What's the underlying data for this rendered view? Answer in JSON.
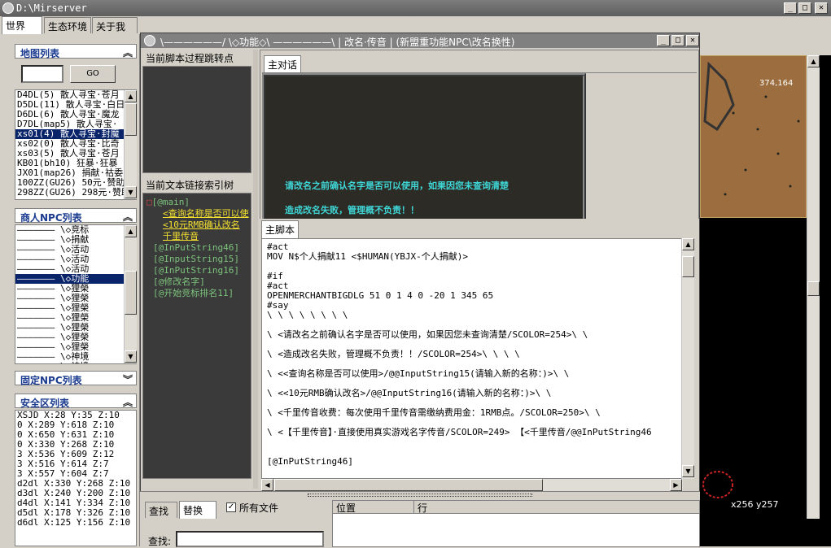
{
  "window": {
    "title": "D:\\Mirserver"
  },
  "main_tabs": [
    "世界",
    "生态环境",
    "关于我们"
  ],
  "map_list": {
    "title": "地图列表",
    "go_label": "GO",
    "search_value": "",
    "items": [
      "D4DL(5) 散人寻宝·苍月",
      "D5DL(11) 散人寻宝·白日",
      "D6DL(6) 散人寻宝·魔龙",
      "D7DL(map5) 散人寻宝·",
      "xs01(4) 散人寻宝·封魔",
      "xs02(0) 散人寻宝·比奇",
      "xs03(5) 散人寻宝·苍月",
      "KB01(bh10) 狂暴·狂暴",
      "JX01(map26) 捐献·祜委",
      "100ZZ(GU26) 50元·赞助",
      "298ZZ(GU26) 298元·赞助"
    ],
    "selected_index": 4
  },
  "npc_list": {
    "title": "商人NPC列表",
    "items": [
      "\\◇竞标",
      "\\◇捐献",
      "\\◇活动",
      "\\◇活动",
      "\\◇活动",
      "\\◇功能",
      "\\◇狸榮",
      "\\◇狸榮",
      "\\◇狸榮",
      "\\◇狸榮",
      "\\◇狸榮",
      "\\◇狸榮",
      "\\◇狸榮",
      "\\◇神境",
      "\\◇神境"
    ],
    "selected_index": 5
  },
  "fixed_npc": {
    "title": "固定NPC列表"
  },
  "safe_zone": {
    "title": "安全区列表",
    "items": [
      "XSJD X:28 Y:35 Z:10",
      "0 X:289 Y:618 Z:10",
      "0 X:650 Y:631 Z:10",
      "0 X:330 Y:268 Z:10",
      "3 X:536 Y:609 Z:12",
      "3 X:516 Y:614 Z:7",
      "3 X:557 Y:604 Z:7",
      "d2dl X:330 Y:268 Z:10",
      "d3dl X:240 Y:200 Z:10",
      "d4dl X:141 Y:334 Z:10",
      "d5dl X:178 Y:326 Z:10",
      "d6dl X:125 Y:156 Z:10"
    ]
  },
  "dialog": {
    "title": "\\——————/ \\◇功能◇\\ ——————\\ | 改名·传音 |   (新盟重功能NPC\\改名换性)",
    "jump_label": "当前脚本过程跳转点",
    "link_label": "当前文本链接索引树",
    "tab_main_dialog": "主对话",
    "tab_main_script": "主脚本",
    "preview_lines": [
      "请改名之前确认名字是否可以使用，如果因您未查询清楚",
      "造成改名失败，管理概不负责！！"
    ],
    "tree": [
      {
        "text": "[@main]",
        "level": 0
      },
      {
        "text": "<查询名称是否可以使",
        "level": 2,
        "link": true
      },
      {
        "text": "<10元RMB确认改名",
        "level": 2,
        "link": true
      },
      {
        "text": "千里传音",
        "level": 2,
        "link": true
      },
      {
        "text": "[@InPutString46]",
        "level": 1
      },
      {
        "text": "[@InputString15]",
        "level": 1
      },
      {
        "text": "[@InPutString16]",
        "level": 1
      },
      {
        "text": "[@修改名字]",
        "level": 1
      },
      {
        "text": "[@开始竞标排名11]",
        "level": 1
      }
    ],
    "code": [
      "#act",
      "MOV N$个人捐献11 <$HUMAN(YBJX-个人捐献)>",
      "",
      "#if",
      "#act",
      "OPENMERCHANTBIGDLG 51 0 1 4 0 -20 1 345 65",
      "#say",
      "\\ \\ \\ \\ \\ \\ \\ \\",
      "",
      "\\    <请改名之前确认名字是否可以使用，如果因您未查询清楚/SCOLOR=254>\\ \\",
      "",
      "\\    <造成改名失败，管理概不负责！！/SCOLOR=254>\\ \\ \\ \\",
      "",
      "\\      <<查询名称是否可以使用>/@@InputString15(请输入新的名称：)>\\ \\",
      "",
      "\\      <<10元RMB确认改名>/@@InputString16(请输入新的名称：)>\\ \\",
      "",
      "\\    <千里传音收费：每次使用千里传音需缴纳费用金：1RMB点。/SCOLOR=250>\\ \\",
      "",
      "\\    <【千里传音】·直接使用真实游戏名字传音/SCOLOR=249>    【<千里传音/@@InPutString46",
      "",
      "",
      "[@InPutString46]"
    ]
  },
  "find": {
    "tab_find": "查找",
    "tab_replace": "替换",
    "all_files_label": "所有文件",
    "all_files_checked": true,
    "find_label": "查找:",
    "col_position": "位置",
    "col_line": "行"
  },
  "map_view": {
    "coord_top": "374,164",
    "coord_bottom": "x256 y257"
  },
  "colors": {
    "selection": "#0a246a",
    "tree_link": "#f4e030",
    "tree_node": "#7cc47c",
    "preview_text": "#3fd6d6"
  }
}
